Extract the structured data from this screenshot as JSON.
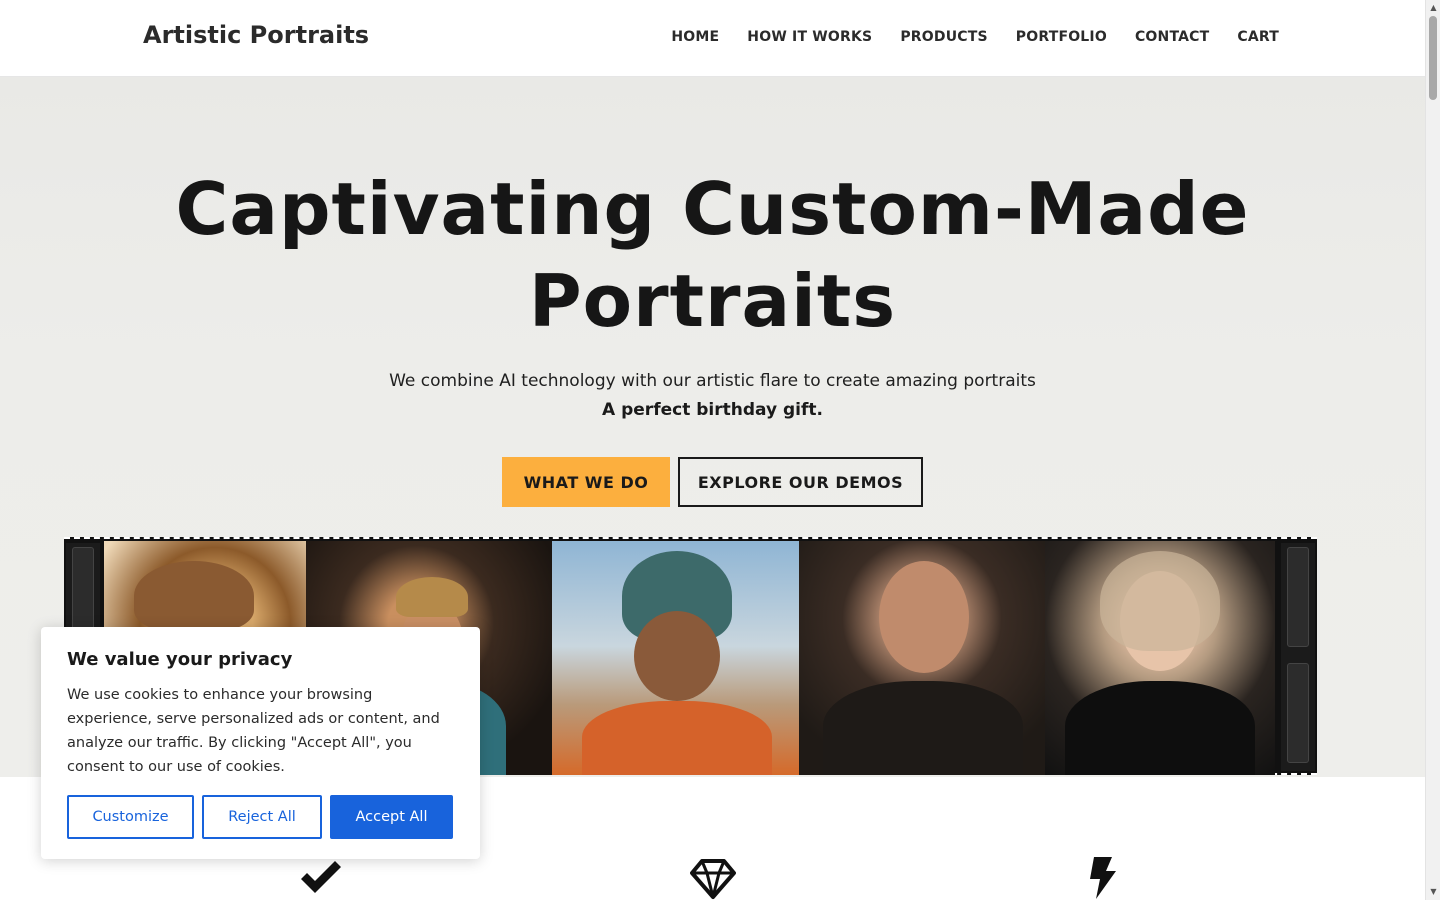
{
  "header": {
    "brand": "Artistic Portraits",
    "nav": [
      "HOME",
      "HOW IT WORKS",
      "PRODUCTS",
      "PORTFOLIO",
      "CONTACT",
      "CART"
    ]
  },
  "hero": {
    "title_line1": "Captivating Custom-Made",
    "title_line2": "Portraits",
    "subtitle": "We combine AI technology with our artistic flare to create amazing portraits",
    "subtitle_bold": "A perfect birthday gift.",
    "primary_button": "WHAT WE DO",
    "secondary_button": "EXPLORE OUR DEMOS",
    "accent_color": "#fcaf3e"
  },
  "features": {
    "icons": [
      "check-icon",
      "gem-icon",
      "bolt-icon"
    ]
  },
  "cookie_banner": {
    "title": "We value your privacy",
    "text": "We use cookies to enhance your browsing experience, serve personalized ads or content, and analyze our traffic. By clicking \"Accept All\", you consent to our use of cookies.",
    "customize": "Customize",
    "reject": "Reject All",
    "accept": "Accept All",
    "accent_color": "#1863dc"
  }
}
